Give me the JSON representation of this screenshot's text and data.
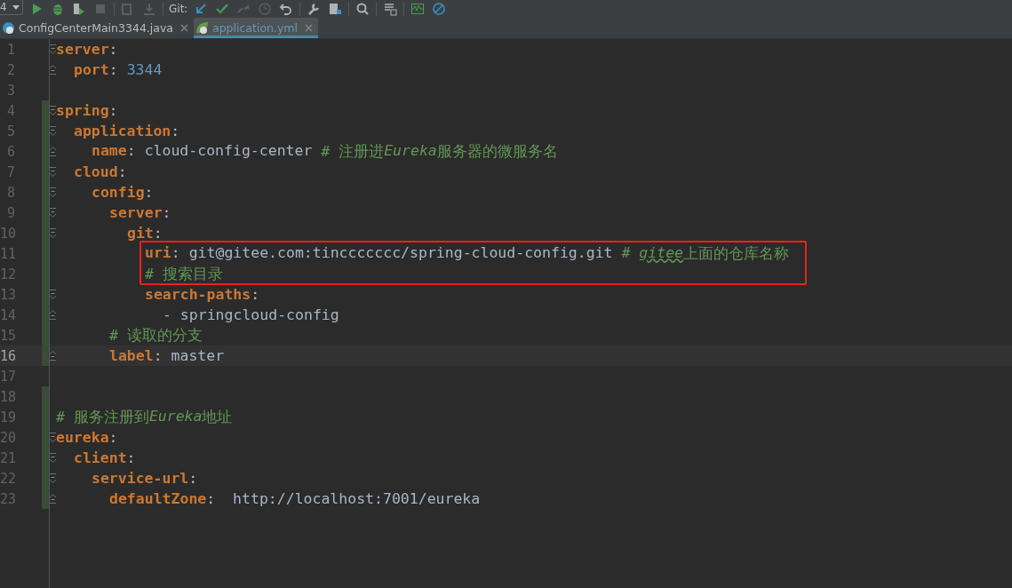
{
  "toolbar": {
    "config_dropdown": "4",
    "vcs_label": "Git:",
    "buttons": [
      {
        "kind": "run",
        "disabled": false
      },
      {
        "kind": "debug",
        "disabled": false
      },
      {
        "kind": "coverage",
        "disabled": false
      },
      {
        "kind": "stop",
        "disabled": true
      },
      {
        "kind": "divider"
      },
      {
        "kind": "build",
        "disabled": true
      },
      {
        "kind": "deploy",
        "disabled": true
      },
      {
        "kind": "divider"
      },
      {
        "kind": "vcs-label"
      },
      {
        "kind": "update",
        "disabled": false
      },
      {
        "kind": "commit",
        "disabled": false
      },
      {
        "kind": "merge",
        "disabled": true
      },
      {
        "kind": "history",
        "disabled": true
      },
      {
        "kind": "undo",
        "disabled": false
      },
      {
        "kind": "divider"
      },
      {
        "kind": "wrench",
        "disabled": false
      },
      {
        "kind": "structure",
        "disabled": false
      },
      {
        "kind": "divider"
      },
      {
        "kind": "search",
        "disabled": false
      },
      {
        "kind": "divider"
      },
      {
        "kind": "tasks",
        "disabled": false
      },
      {
        "kind": "divider"
      },
      {
        "kind": "monitor",
        "disabled": false
      },
      {
        "kind": "block",
        "disabled": false
      }
    ]
  },
  "tabs": [
    {
      "label": "ConfigCenterMain3344.java",
      "kind": "java",
      "selected": false
    },
    {
      "label": "application.yml",
      "kind": "yaml",
      "selected": true
    }
  ],
  "editor": {
    "lines": [
      {
        "number": "1",
        "fold_start": true,
        "fold_end": false,
        "changed": false,
        "current": false,
        "boxed": false,
        "tokens": [
          {
            "kind": "key",
            "text": "server"
          },
          {
            "kind": "punct",
            "text": ":"
          }
        ],
        "children": [
          {
            "number": "2",
            "fold_start": false,
            "fold_end": true,
            "changed": false,
            "current": false,
            "boxed": false,
            "tokens": [
              {
                "kind": "key",
                "text": "port"
              },
              {
                "kind": "punct",
                "text": ": "
              },
              {
                "kind": "number",
                "text": "3344"
              }
            ]
          }
        ]
      },
      {
        "number": "3",
        "fold_start": false,
        "fold_end": false,
        "changed": false,
        "current": false,
        "boxed": false
      },
      {
        "number": "4",
        "fold_start": true,
        "fold_end": false,
        "changed": true,
        "current": false,
        "boxed": false,
        "tokens": [
          {
            "kind": "key",
            "text": "spring"
          },
          {
            "kind": "punct",
            "text": ":"
          }
        ],
        "children": [
          {
            "number": "5",
            "fold_start": true,
            "fold_end": false,
            "changed": true,
            "current": false,
            "boxed": false,
            "tokens": [
              {
                "kind": "key",
                "text": "application"
              },
              {
                "kind": "punct",
                "text": ":"
              }
            ],
            "children": [
              {
                "number": "6",
                "fold_start": false,
                "fold_end": true,
                "changed": true,
                "current": false,
                "boxed": false,
                "tokens": [
                  {
                    "kind": "key",
                    "text": "name"
                  },
                  {
                    "kind": "punct",
                    "text": ": "
                  },
                  {
                    "kind": "value",
                    "text": "cloud-config-center "
                  },
                  {
                    "kind": "comment",
                    "text": "# 注册进"
                  },
                  {
                    "kind": "comment-italic",
                    "text": "Eureka"
                  },
                  {
                    "kind": "comment",
                    "text": "服务器的微服务名"
                  }
                ]
              }
            ]
          },
          {
            "number": "7",
            "fold_start": true,
            "fold_end": false,
            "changed": true,
            "current": false,
            "boxed": false,
            "tokens": [
              {
                "kind": "key",
                "text": "cloud"
              },
              {
                "kind": "punct",
                "text": ":"
              }
            ],
            "children": [
              {
                "number": "8",
                "fold_start": true,
                "fold_end": false,
                "changed": true,
                "current": false,
                "boxed": false,
                "tokens": [
                  {
                    "kind": "key",
                    "text": "config"
                  },
                  {
                    "kind": "punct",
                    "text": ":"
                  }
                ],
                "children": [
                  {
                    "number": "9",
                    "fold_start": true,
                    "fold_end": false,
                    "changed": true,
                    "current": false,
                    "boxed": false,
                    "tokens": [
                      {
                        "kind": "key",
                        "text": "server"
                      },
                      {
                        "kind": "punct",
                        "text": ":"
                      }
                    ],
                    "children": [
                      {
                        "number": "10",
                        "fold_start": true,
                        "fold_end": false,
                        "changed": true,
                        "current": false,
                        "boxed": false,
                        "tokens": [
                          {
                            "kind": "key",
                            "text": "git"
                          },
                          {
                            "kind": "punct",
                            "text": ":"
                          }
                        ],
                        "children": [
                          {
                            "number": "11",
                            "fold_start": false,
                            "fold_end": false,
                            "changed": true,
                            "current": false,
                            "boxed": true,
                            "tokens": [
                              {
                                "kind": "key",
                                "text": "uri"
                              },
                              {
                                "kind": "punct",
                                "text": ": "
                              },
                              {
                                "kind": "value",
                                "text": "git@gitee.com:tinccccccc/spring-cloud-config.git "
                              },
                              {
                                "kind": "comment",
                                "text": "# "
                              },
                              {
                                "kind": "comment-typo",
                                "text": "gitee"
                              },
                              {
                                "kind": "comment",
                                "text": "上面的仓库名称"
                              }
                            ]
                          },
                          {
                            "number": "12",
                            "fold_start": false,
                            "fold_end": false,
                            "changed": true,
                            "current": false,
                            "boxed": true,
                            "tokens": [
                              {
                                "kind": "comment",
                                "text": "# 搜索目录"
                              }
                            ]
                          },
                          {
                            "number": "13",
                            "fold_start": true,
                            "fold_end": false,
                            "changed": true,
                            "current": false,
                            "boxed": false,
                            "tokens": [
                              {
                                "kind": "key",
                                "text": "search-paths"
                              },
                              {
                                "kind": "punct",
                                "text": ":"
                              }
                            ],
                            "children": [
                              {
                                "number": "14",
                                "fold_start": false,
                                "fold_end": true,
                                "changed": true,
                                "current": false,
                                "boxed": false,
                                "tokens": [
                                  {
                                    "kind": "value",
                                    "text": "- springcloud-config"
                                  }
                                ]
                              }
                            ]
                          }
                        ]
                      }
                    ]
                  },
                  {
                    "number": "15",
                    "fold_start": false,
                    "fold_end": false,
                    "changed": true,
                    "current": false,
                    "boxed": false,
                    "tokens": [
                      {
                        "kind": "comment",
                        "text": "# 读取的分支"
                      }
                    ]
                  },
                  {
                    "number": "16",
                    "fold_start": false,
                    "fold_end": true,
                    "changed": true,
                    "current": true,
                    "boxed": false,
                    "tokens": [
                      {
                        "kind": "key",
                        "text": "label"
                      },
                      {
                        "kind": "punct",
                        "text": ": "
                      },
                      {
                        "kind": "value",
                        "text": "master"
                      }
                    ]
                  }
                ]
              }
            ]
          }
        ]
      },
      {
        "number": "17",
        "fold_start": false,
        "fold_end": false,
        "changed": false,
        "current": false,
        "boxed": false
      },
      {
        "number": "18",
        "fold_start": false,
        "fold_end": false,
        "changed": true,
        "current": false,
        "boxed": false
      },
      {
        "number": "19",
        "fold_start": false,
        "fold_end": false,
        "changed": true,
        "current": false,
        "boxed": false,
        "tokens": [
          {
            "kind": "comment",
            "text": "# 服务注册到"
          },
          {
            "kind": "comment-italic",
            "text": "Eureka"
          },
          {
            "kind": "comment",
            "text": "地址"
          }
        ]
      },
      {
        "number": "20",
        "fold_start": true,
        "fold_end": false,
        "changed": true,
        "current": false,
        "boxed": false,
        "tokens": [
          {
            "kind": "key",
            "text": "eureka"
          },
          {
            "kind": "punct",
            "text": ":"
          }
        ],
        "children": [
          {
            "number": "21",
            "fold_start": true,
            "fold_end": false,
            "changed": true,
            "current": false,
            "boxed": false,
            "tokens": [
              {
                "kind": "key",
                "text": "client"
              },
              {
                "kind": "punct",
                "text": ":"
              }
            ],
            "children": [
              {
                "number": "22",
                "fold_start": true,
                "fold_end": false,
                "changed": true,
                "current": false,
                "boxed": false,
                "tokens": [
                  {
                    "kind": "key",
                    "text": "service-url"
                  },
                  {
                    "kind": "punct",
                    "text": ":"
                  }
                ],
                "children": [
                  {
                    "number": "23",
                    "fold_start": false,
                    "fold_end": true,
                    "changed": true,
                    "current": false,
                    "boxed": false,
                    "tokens": [
                      {
                        "kind": "key",
                        "text": "defaultZone"
                      },
                      {
                        "kind": "punct",
                        "text": ":  "
                      },
                      {
                        "kind": "value",
                        "text": "http://localhost:7001/eureka"
                      }
                    ]
                  }
                ]
              }
            ]
          }
        ]
      }
    ]
  }
}
